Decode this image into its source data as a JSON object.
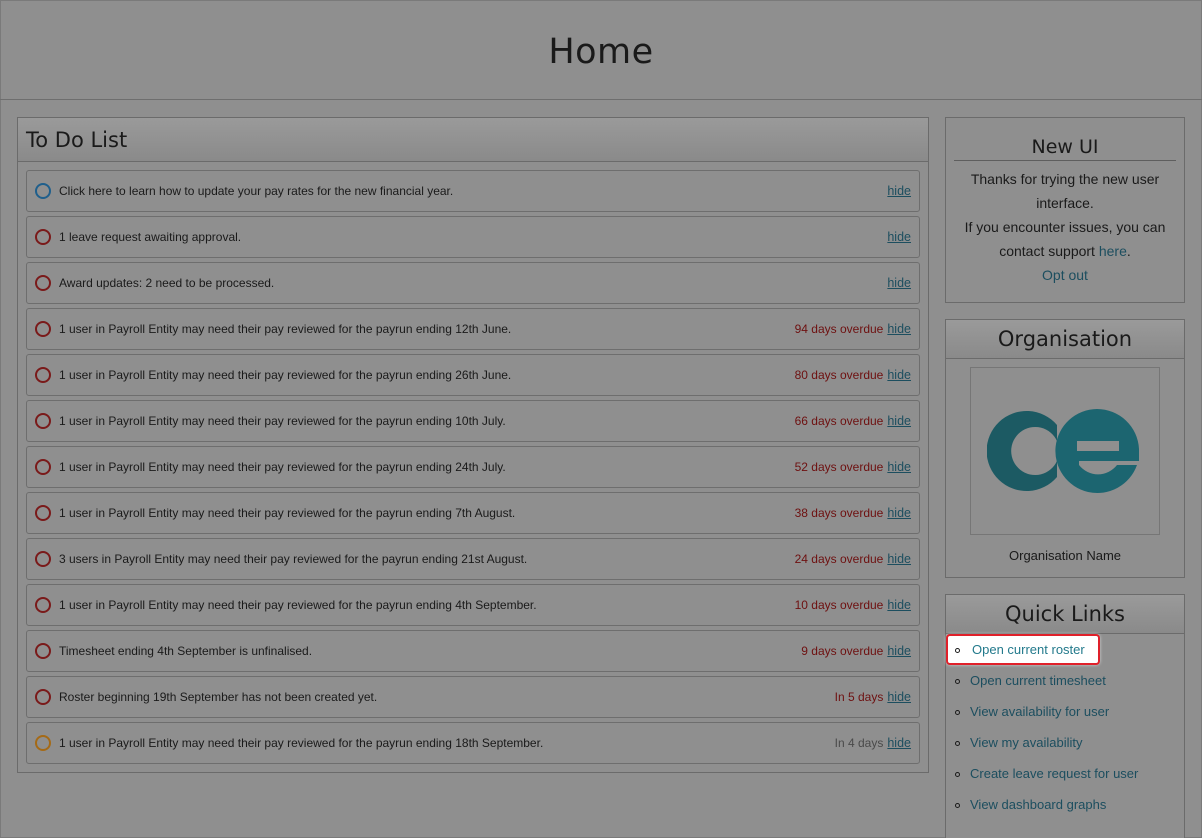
{
  "page": {
    "title": "Home"
  },
  "todo": {
    "title": "To Do List",
    "hide_label": "hide",
    "items": [
      {
        "type": "info",
        "text": "Click here to learn how to update your pay rates for the new financial year.",
        "status": ""
      },
      {
        "type": "alert",
        "text": "1 leave request awaiting approval.",
        "status": ""
      },
      {
        "type": "alert",
        "text": "Award updates: 2 need to be processed.",
        "status": ""
      },
      {
        "type": "alert",
        "text": "1 user in Payroll Entity may need their pay reviewed for the payrun ending 12th June.",
        "status": "94 days overdue"
      },
      {
        "type": "alert",
        "text": "1 user in Payroll Entity may need their pay reviewed for the payrun ending 26th June.",
        "status": "80 days overdue"
      },
      {
        "type": "alert",
        "text": "1 user in Payroll Entity may need their pay reviewed for the payrun ending 10th July.",
        "status": "66 days overdue"
      },
      {
        "type": "alert",
        "text": "1 user in Payroll Entity may need their pay reviewed for the payrun ending 24th July.",
        "status": "52 days overdue"
      },
      {
        "type": "alert",
        "text": "1 user in Payroll Entity may need their pay reviewed for the payrun ending 7th August.",
        "status": "38 days overdue"
      },
      {
        "type": "alert",
        "text": "3 users in Payroll Entity may need their pay reviewed for the payrun ending 21st August.",
        "status": "24 days overdue"
      },
      {
        "type": "alert",
        "text": "1 user in Payroll Entity may need their pay reviewed for the payrun ending 4th September.",
        "status": "10 days overdue"
      },
      {
        "type": "alert",
        "text": "Timesheet ending 4th September is unfinalised.",
        "status": "9 days overdue"
      },
      {
        "type": "alert",
        "text": "Roster beginning 19th September has not been created yet.",
        "status": "In 5 days"
      },
      {
        "type": "warn",
        "text": "1 user in Payroll Entity may need their pay reviewed for the payrun ending 18th September.",
        "status": "In 4 days"
      }
    ]
  },
  "new_ui": {
    "title": "New UI",
    "line1": "Thanks for trying the new user interface.",
    "line2_prefix": "If you encounter issues, you can contact support ",
    "line2_link": "here",
    "line2_suffix": ".",
    "opt_out": "Opt out"
  },
  "organisation": {
    "title": "Organisation",
    "logo_icon": "ce-logo",
    "logo_color": "#1c5a63",
    "name": "Organisation Name"
  },
  "quick_links": {
    "title": "Quick Links",
    "items": [
      "Open current roster",
      "Open current timesheet",
      "View availability for user",
      "View my availability",
      "Create leave request for user",
      "View dashboard graphs"
    ]
  }
}
